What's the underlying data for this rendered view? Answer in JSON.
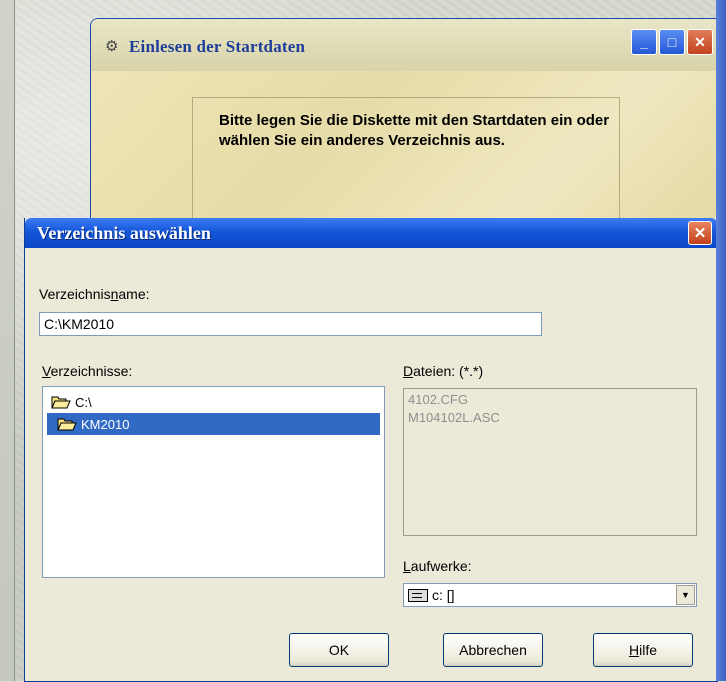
{
  "background_window": {
    "title": "Einlesen der Startdaten",
    "message": "Bitte legen Sie die Diskette mit den Startdaten ein oder wählen Sie ein anderes Verzeichnis aus.",
    "controls": [
      "minimize-icon",
      "maximize-icon",
      "close-icon"
    ]
  },
  "dialog": {
    "title": "Verzeichnis auswählen",
    "dirname_label_pre": "Verzeichnis",
    "dirname_label_ul": "n",
    "dirname_label_post": "ame:",
    "dirname_value": "C:\\KM2010",
    "dirs_label_ul": "V",
    "dirs_label_post": "erzeichnisse:",
    "directories": [
      {
        "label": "C:\\",
        "icon": "open-folder-icon"
      },
      {
        "label": "KM2010",
        "icon": "open-folder-icon",
        "selected": true
      }
    ],
    "files_label_ul": "D",
    "files_label_post": "ateien: (*.*)",
    "files": [
      "4102.CFG",
      "M104102L.ASC"
    ],
    "drives_label_ul": "L",
    "drives_label_post": "aufwerke:",
    "drive_value": "c: []",
    "buttons": {
      "ok": "OK",
      "cancel": "Abbrechen",
      "help_ul": "H",
      "help_post": "ilfe"
    }
  }
}
